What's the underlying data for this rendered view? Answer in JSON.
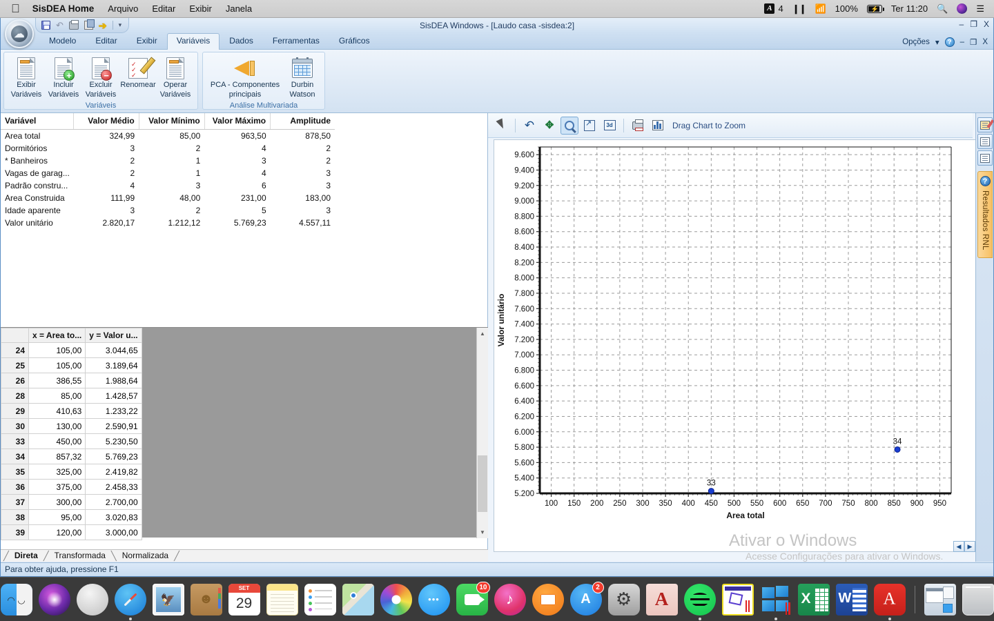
{
  "mac_menubar": {
    "apple_icon": "apple-icon",
    "app_name": "SisDEA Home",
    "menus": [
      "Arquivo",
      "Editar",
      "Exibir",
      "Janela"
    ],
    "status": {
      "adobe_count": "4",
      "battery_pct": "100%",
      "clock": "Ter 11:20"
    }
  },
  "window": {
    "title": "SisDEA Windows - [Laudo casa -sisdea:2]",
    "controls": {
      "minimize": "‒",
      "restore": "❐",
      "close": "X"
    },
    "quick_access": [
      "save-icon",
      "undo-icon",
      "print-icon",
      "copy-icon",
      "export-icon",
      "qat-dropdown-icon"
    ]
  },
  "ribbon": {
    "tabs": [
      {
        "label": "Modelo",
        "active": false
      },
      {
        "label": "Editar",
        "active": false
      },
      {
        "label": "Exibir",
        "active": false
      },
      {
        "label": "Variáveis",
        "active": true
      },
      {
        "label": "Dados",
        "active": false
      },
      {
        "label": "Ferramentas",
        "active": false
      },
      {
        "label": "Gráficos",
        "active": false
      }
    ],
    "right": {
      "options_label": "Opções",
      "dropdown": "▾",
      "help": "?",
      "minimize": "‒",
      "restore": "❐",
      "close": "X"
    },
    "groups": [
      {
        "title": "Variáveis",
        "buttons": [
          {
            "line1": "Exibir",
            "line2": "Variáveis",
            "icon": "document-list-icon"
          },
          {
            "line1": "Incluir",
            "line2": "Variáveis",
            "icon": "document-add-icon"
          },
          {
            "line1": "Excluir",
            "line2": "Variáveis",
            "icon": "document-remove-icon"
          },
          {
            "line1": "Renomear",
            "line2": "",
            "icon": "document-edit-icon"
          },
          {
            "line1": "Operar",
            "line2": "Variáveis",
            "icon": "document-operate-icon"
          }
        ]
      },
      {
        "title": "Análise Multivariada",
        "buttons": [
          {
            "line1": "PCA - Componentes",
            "line2": "principais",
            "icon": "pca-wedge-icon"
          },
          {
            "line1": "Durbin",
            "line2": "Watson",
            "icon": "durbin-table-icon"
          }
        ]
      }
    ]
  },
  "stats_table": {
    "headers": [
      "Variável",
      "Valor Médio",
      "Valor Mínimo",
      "Valor Máximo",
      "Amplitude"
    ],
    "rows": [
      [
        "Area total",
        "324,99",
        "85,00",
        "963,50",
        "878,50"
      ],
      [
        "Dormitórios",
        "3",
        "2",
        "4",
        "2"
      ],
      [
        "* Banheiros",
        "2",
        "1",
        "3",
        "2"
      ],
      [
        "Vagas de garag...",
        "2",
        "1",
        "4",
        "3"
      ],
      [
        "Padrão constru...",
        "4",
        "3",
        "6",
        "3"
      ],
      [
        "Area Construida",
        "111,99",
        "48,00",
        "231,00",
        "183,00"
      ],
      [
        "Idade aparente",
        "3",
        "2",
        "5",
        "3"
      ],
      [
        "Valor unitário",
        "2.820,17",
        "1.212,12",
        "5.769,23",
        "4.557,11"
      ]
    ]
  },
  "data_grid": {
    "headers": [
      "",
      "x = Area to...",
      "y = Valor u..."
    ],
    "rows": [
      [
        "24",
        "105,00",
        "3.044,65"
      ],
      [
        "25",
        "105,00",
        "3.189,64"
      ],
      [
        "26",
        "386,55",
        "1.988,64"
      ],
      [
        "28",
        "85,00",
        "1.428,57"
      ],
      [
        "29",
        "410,63",
        "1.233,22"
      ],
      [
        "30",
        "130,00",
        "2.590,91"
      ],
      [
        "33",
        "450,00",
        "5.230,50"
      ],
      [
        "34",
        "857,32",
        "5.769,23"
      ],
      [
        "35",
        "325,00",
        "2.419,82"
      ],
      [
        "36",
        "375,00",
        "2.458,33"
      ],
      [
        "37",
        "300,00",
        "2.700,00"
      ],
      [
        "38",
        "95,00",
        "3.020,83"
      ],
      [
        "39",
        "120,00",
        "3.000,00"
      ]
    ]
  },
  "bottom_tabs": [
    {
      "label": "Direta",
      "active": true
    },
    {
      "label": "Transformada",
      "active": false
    },
    {
      "label": "Normalizada",
      "active": false
    }
  ],
  "chart_toolbar": {
    "buttons": [
      "pointer-icon",
      "undo-icon",
      "pan-icon",
      "zoom-icon",
      "rotate-icon",
      "three-d-icon",
      "print-icon",
      "chart-icon"
    ],
    "hint": "Drag Chart to Zoom"
  },
  "right_strip": {
    "buttons": [
      "edit-chart-icon",
      "report-icon",
      "report2-icon"
    ],
    "rnl_tab": {
      "help": "?",
      "label": "Resultados RNL"
    }
  },
  "status_bar": {
    "text": "Para obter ajuda, pressione F1"
  },
  "watermark": {
    "line1": "Ativar o Windows",
    "line2": "Acesse Configurações para ativar o Windows."
  },
  "chart_data": {
    "type": "scatter",
    "title": "",
    "xlabel": "Area total",
    "ylabel": "Valor unitário",
    "xlim": [
      75,
      975
    ],
    "ylim": [
      5200,
      9700
    ],
    "xticks": [
      100,
      150,
      200,
      250,
      300,
      350,
      400,
      450,
      500,
      550,
      600,
      650,
      700,
      750,
      800,
      850,
      900,
      950
    ],
    "yticks": [
      5200,
      5400,
      5600,
      5800,
      6000,
      6200,
      6400,
      6600,
      6800,
      7000,
      7200,
      7400,
      7600,
      7800,
      8000,
      8200,
      8400,
      8600,
      8800,
      9000,
      9200,
      9400,
      9600
    ],
    "ytick_labels": [
      "5.200",
      "5.400",
      "5.600",
      "5.800",
      "6.000",
      "6.200",
      "6.400",
      "6.600",
      "6.800",
      "7.000",
      "7.200",
      "7.400",
      "7.600",
      "7.800",
      "8.000",
      "8.200",
      "8.400",
      "8.600",
      "8.800",
      "9.000",
      "9.200",
      "9.400",
      "9.600"
    ],
    "grid": true,
    "legend": "none",
    "point_color": "#1a3fd0",
    "points": [
      {
        "label": "33",
        "x": 450.0,
        "y": 5230.5
      },
      {
        "label": "34",
        "x": 857.32,
        "y": 5769.23
      }
    ]
  },
  "dock": {
    "items": [
      {
        "name": "finder",
        "running": true
      },
      {
        "name": "siri",
        "running": false
      },
      {
        "name": "launchpad",
        "running": false
      },
      {
        "name": "safari",
        "running": true
      },
      {
        "name": "mail",
        "running": false
      },
      {
        "name": "contacts",
        "running": false
      },
      {
        "name": "calendar",
        "running": false,
        "month": "SET",
        "day": "29"
      },
      {
        "name": "notes",
        "running": false
      },
      {
        "name": "reminders",
        "running": false
      },
      {
        "name": "maps",
        "running": false
      },
      {
        "name": "photos",
        "running": false
      },
      {
        "name": "messages",
        "running": false
      },
      {
        "name": "facetime",
        "running": false,
        "badge": "10"
      },
      {
        "name": "itunes",
        "running": false
      },
      {
        "name": "books",
        "running": false
      },
      {
        "name": "app-store",
        "running": false,
        "badge": "2"
      },
      {
        "name": "system-preferences",
        "running": false
      },
      {
        "name": "autocad",
        "running": false
      },
      {
        "name": "spotify",
        "running": true
      },
      {
        "name": "sisdea",
        "running": true
      },
      {
        "name": "windows",
        "running": true
      },
      {
        "name": "excel",
        "running": true
      },
      {
        "name": "word",
        "running": true
      },
      {
        "name": "acrobat",
        "running": true
      },
      {
        "name": "stack",
        "running": false
      },
      {
        "name": "trash",
        "running": false
      }
    ]
  }
}
